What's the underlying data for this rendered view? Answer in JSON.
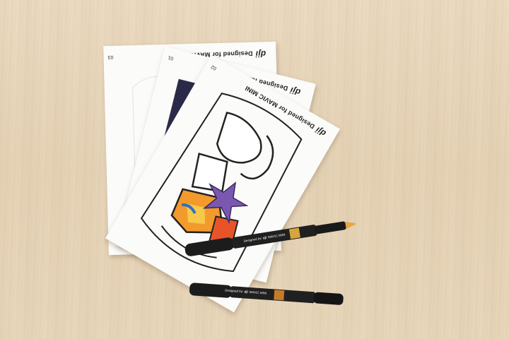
{
  "sheets": [
    {
      "number": "03",
      "brand": "dji",
      "label": "Designed for MAVIC MINI"
    },
    {
      "number": "01",
      "brand": "dji",
      "label": "Designed for MAVIC MINI"
    },
    {
      "number": "02",
      "brand": "dji",
      "label": "Designed for MAVIC MINI"
    }
  ],
  "pens": [
    {
      "brand": "dji",
      "label_prefix": "Designed for",
      "label_suffix": "MAVIC MINI",
      "tip_color": "#e8a640",
      "band_color": "#d8a43c"
    },
    {
      "brand": "dji",
      "label_prefix": "Designed for",
      "label_suffix": "MAVIC MINI",
      "tip_color": "#1a1a1a",
      "band_color": "#c77a2a"
    }
  ],
  "colors": {
    "table": "#e8d7bb",
    "sheet": "#fbfbfa",
    "pen_body": "#1c1c1c",
    "star": "#7a58b0",
    "accent_orange": "#f29a2c",
    "accent_blue": "#2f6fc4"
  }
}
